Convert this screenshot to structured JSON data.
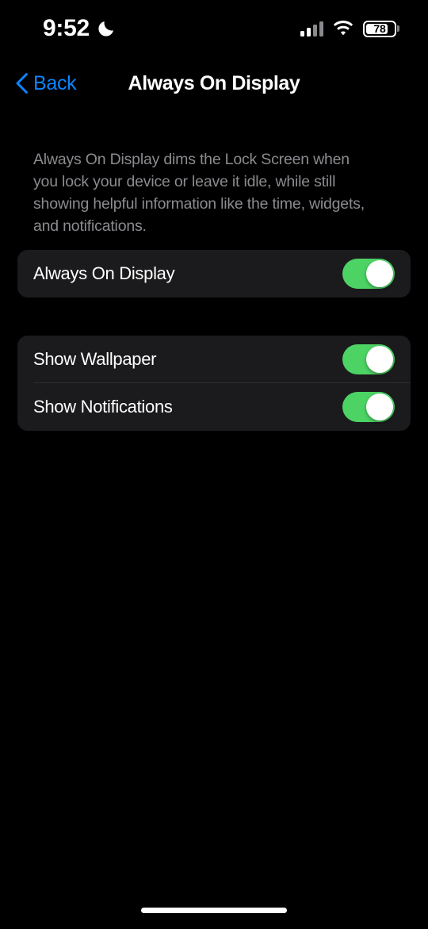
{
  "status_bar": {
    "time": "9:52",
    "focus_icon": "crescent-moon-icon",
    "signal_icon": "cellular-signal-icon",
    "signal_bars_active": 2,
    "signal_bars_total": 4,
    "wifi_icon": "wifi-icon",
    "battery_icon": "battery-icon",
    "battery_percent": "78",
    "battery_level": 78
  },
  "nav": {
    "back_label": "Back",
    "back_icon": "chevron-left-icon",
    "title": "Always On Display"
  },
  "description": "Always On Display dims the Lock Screen when you lock your device or leave it idle, while still showing helpful information like the time, widgets, and notifications.",
  "groups": [
    {
      "id": "aod",
      "rows": [
        {
          "label": "Always On Display",
          "toggle": "on"
        }
      ]
    },
    {
      "id": "options",
      "rows": [
        {
          "label": "Show Wallpaper",
          "toggle": "on"
        },
        {
          "label": "Show Notifications",
          "toggle": "on"
        }
      ]
    }
  ],
  "home_indicator": "home-indicator",
  "colors": {
    "background": "#000000",
    "card": "#1b1b1d",
    "separator": "#2e2e30",
    "accent_blue": "#0A84FF",
    "toggle_on_green": "#4cd364",
    "primary_text": "#ffffff",
    "secondary_text": "#8b8b90"
  }
}
